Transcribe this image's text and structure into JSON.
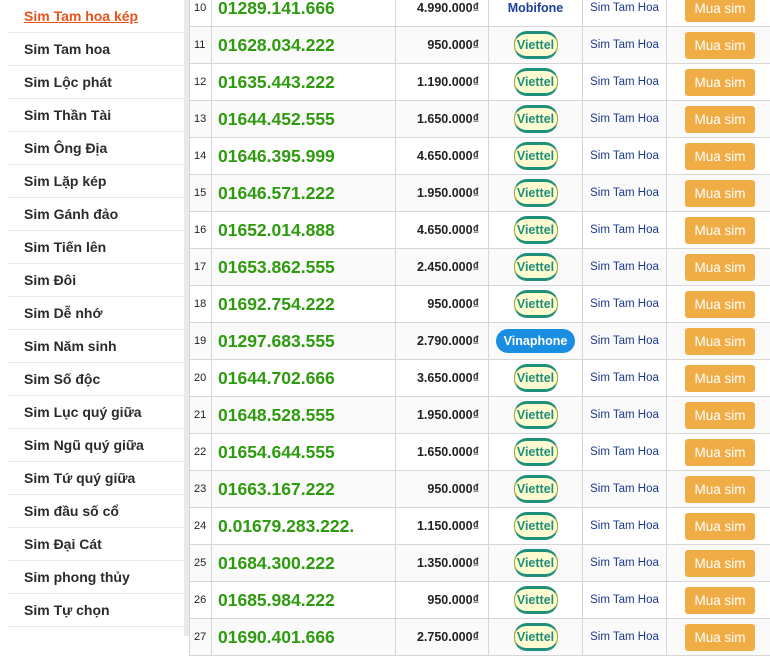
{
  "sidebar": {
    "items": [
      {
        "label": "Sim Tam hoa kép",
        "active": true
      },
      {
        "label": "Sim Tam hoa",
        "active": false
      },
      {
        "label": "Sim Lộc phát",
        "active": false
      },
      {
        "label": "Sim Thần Tài",
        "active": false
      },
      {
        "label": "Sim Ông Địa",
        "active": false
      },
      {
        "label": "Sim Lặp kép",
        "active": false
      },
      {
        "label": "Sim Gánh đảo",
        "active": false
      },
      {
        "label": "Sim Tiến lên",
        "active": false
      },
      {
        "label": "Sim Đôi",
        "active": false
      },
      {
        "label": "Sim Dễ nhớ",
        "active": false
      },
      {
        "label": "Sim Năm sinh",
        "active": false
      },
      {
        "label": "Sim Số độc",
        "active": false
      },
      {
        "label": "Sim Lục quý giữa",
        "active": false
      },
      {
        "label": "Sim Ngũ quý giữa",
        "active": false
      },
      {
        "label": "Sim Tứ quý giữa",
        "active": false
      },
      {
        "label": "Sim đầu số cổ",
        "active": false
      },
      {
        "label": "Sim Đại Cát",
        "active": false
      },
      {
        "label": "Sim phong thủy",
        "active": false
      },
      {
        "label": "Sim Tự chọn",
        "active": false
      }
    ]
  },
  "table": {
    "buy_label": "Mua sim",
    "rows": [
      {
        "idx": "10",
        "number": "01289.141.666",
        "price": "4.990.000₫",
        "network": "Mobifone",
        "type": "Sim Tam Hoa"
      },
      {
        "idx": "11",
        "number": "01628.034.222",
        "price": "950.000₫",
        "network": "Viettel",
        "type": "Sim Tam Hoa"
      },
      {
        "idx": "12",
        "number": "01635.443.222",
        "price": "1.190.000₫",
        "network": "Viettel",
        "type": "Sim Tam Hoa"
      },
      {
        "idx": "13",
        "number": "01644.452.555",
        "price": "1.650.000₫",
        "network": "Viettel",
        "type": "Sim Tam Hoa"
      },
      {
        "idx": "14",
        "number": "01646.395.999",
        "price": "4.650.000₫",
        "network": "Viettel",
        "type": "Sim Tam Hoa"
      },
      {
        "idx": "15",
        "number": "01646.571.222",
        "price": "1.950.000₫",
        "network": "Viettel",
        "type": "Sim Tam Hoa"
      },
      {
        "idx": "16",
        "number": "01652.014.888",
        "price": "4.650.000₫",
        "network": "Viettel",
        "type": "Sim Tam Hoa"
      },
      {
        "idx": "17",
        "number": "01653.862.555",
        "price": "2.450.000₫",
        "network": "Viettel",
        "type": "Sim Tam Hoa"
      },
      {
        "idx": "18",
        "number": "01692.754.222",
        "price": "950.000₫",
        "network": "Viettel",
        "type": "Sim Tam Hoa"
      },
      {
        "idx": "19",
        "number": "01297.683.555",
        "price": "2.790.000₫",
        "network": "Vinaphone",
        "type": "Sim Tam Hoa"
      },
      {
        "idx": "20",
        "number": "01644.702.666",
        "price": "3.650.000₫",
        "network": "Viettel",
        "type": "Sim Tam Hoa"
      },
      {
        "idx": "21",
        "number": "01648.528.555",
        "price": "1.950.000₫",
        "network": "Viettel",
        "type": "Sim Tam Hoa"
      },
      {
        "idx": "22",
        "number": "01654.644.555",
        "price": "1.650.000₫",
        "network": "Viettel",
        "type": "Sim Tam Hoa"
      },
      {
        "idx": "23",
        "number": "01663.167.222",
        "price": "950.000₫",
        "network": "Viettel",
        "type": "Sim Tam Hoa"
      },
      {
        "idx": "24",
        "number": "0.01679.283.222.",
        "price": "1.150.000₫",
        "network": "Viettel",
        "type": "Sim Tam Hoa"
      },
      {
        "idx": "25",
        "number": "01684.300.222",
        "price": "1.350.000₫",
        "network": "Viettel",
        "type": "Sim Tam Hoa"
      },
      {
        "idx": "26",
        "number": "01685.984.222",
        "price": "950.000₫",
        "network": "Viettel",
        "type": "Sim Tam Hoa"
      },
      {
        "idx": "27",
        "number": "01690.401.666",
        "price": "2.750.000₫",
        "network": "Viettel",
        "type": "Sim Tam Hoa"
      }
    ]
  }
}
